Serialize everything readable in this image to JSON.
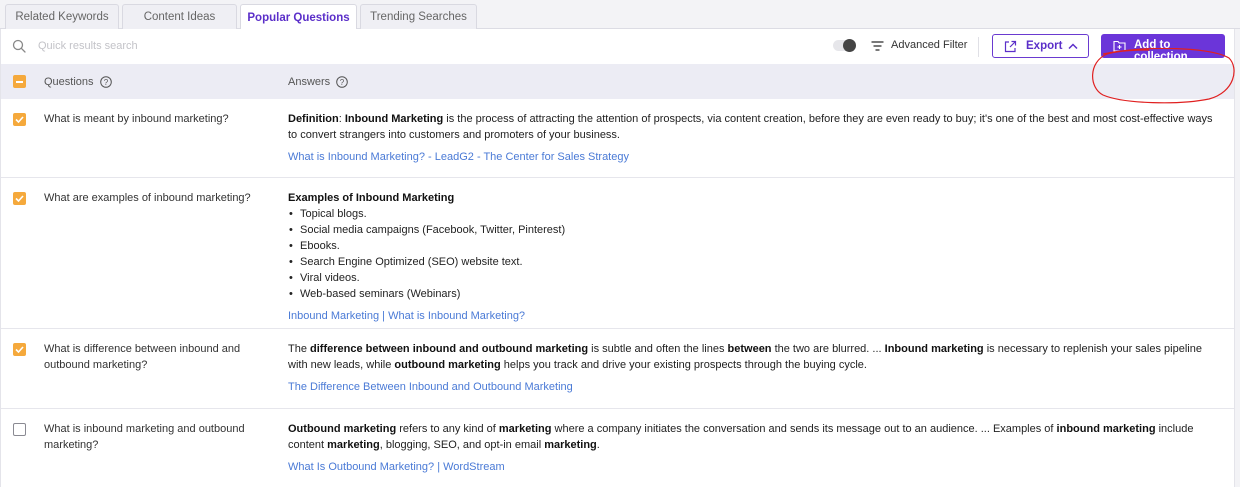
{
  "tabs": [
    {
      "label": "Related Keywords",
      "active": false
    },
    {
      "label": "Content Ideas",
      "active": false
    },
    {
      "label": "Popular Questions",
      "active": true
    },
    {
      "label": "Trending Searches",
      "active": false
    }
  ],
  "toolbar": {
    "search_placeholder": "Quick results search",
    "search_icon": "search-icon",
    "filter_label": "Advanced Filter",
    "export_label": "Export",
    "add_label": "Add to collection"
  },
  "table": {
    "questions_header": "Questions",
    "answers_header": "Answers",
    "rows": [
      {
        "checked": true,
        "question": "What is meant by inbound marketing?",
        "answer_parts": [
          {
            "t": "Definition",
            "b": true
          },
          {
            "t": ": ",
            "b": false
          },
          {
            "t": "Inbound Marketing",
            "b": true
          },
          {
            "t": " is the process of attracting the attention of prospects, via content creation, before they are even ready to buy; it's one of the best and most cost-effective ways to convert strangers into customers and promoters of your business.",
            "b": false
          }
        ],
        "link": "What is Inbound Marketing? - LeadG2 - The Center for Sales Strategy"
      },
      {
        "checked": true,
        "question": "What are examples of inbound marketing?",
        "answer_title": "Examples of Inbound Marketing",
        "answer_list": [
          "Topical blogs.",
          "Social media campaigns (Facebook, Twitter, Pinterest)",
          "Ebooks.",
          "Search Engine Optimized (SEO) website text.",
          "Viral videos.",
          "Web-based seminars (Webinars)"
        ],
        "link": "Inbound Marketing | What is Inbound Marketing?"
      },
      {
        "checked": true,
        "question": "What is difference between inbound and outbound marketing?",
        "answer_parts": [
          {
            "t": "The ",
            "b": false
          },
          {
            "t": "difference between inbound and outbound marketing",
            "b": true
          },
          {
            "t": " is subtle and often the lines ",
            "b": false
          },
          {
            "t": "between",
            "b": true
          },
          {
            "t": " the two are blurred. ... ",
            "b": false
          },
          {
            "t": "Inbound marketing",
            "b": true
          },
          {
            "t": " is necessary to replenish your sales pipeline with new leads, while ",
            "b": false
          },
          {
            "t": "outbound marketing",
            "b": true
          },
          {
            "t": " helps you track and drive your existing prospects through the buying cycle.",
            "b": false
          }
        ],
        "link": "The Difference Between Inbound and Outbound Marketing"
      },
      {
        "checked": false,
        "question": "What is inbound marketing and outbound marketing?",
        "answer_parts": [
          {
            "t": "Outbound marketing",
            "b": true
          },
          {
            "t": " refers to any kind of ",
            "b": false
          },
          {
            "t": "marketing",
            "b": true
          },
          {
            "t": " where a company initiates the conversation and sends its message out to an audience. ... Examples of ",
            "b": false
          },
          {
            "t": "inbound marketing",
            "b": true
          },
          {
            "t": " include content ",
            "b": false
          },
          {
            "t": "marketing",
            "b": true
          },
          {
            "t": ", blogging, SEO, and opt-in email ",
            "b": false
          },
          {
            "t": "marketing",
            "b": true
          },
          {
            "t": ".",
            "b": false
          }
        ],
        "link": "What Is Outbound Marketing? | WordStream"
      }
    ]
  },
  "colors": {
    "accent": "#6b35d9",
    "checkbox": "#f5a93c",
    "link": "#4a7ad6",
    "annotation": "#e02020"
  }
}
